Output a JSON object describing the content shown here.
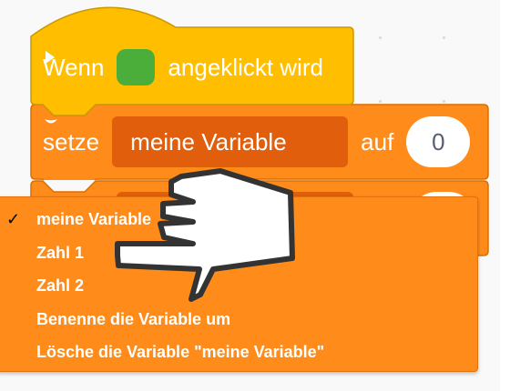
{
  "hat_block": {
    "text_before": "Wenn",
    "text_after": "angeklickt wird",
    "icon": "green-flag-icon"
  },
  "set_block": {
    "label": "setze",
    "variable": "meine Variable",
    "connector": "auf",
    "value": "0"
  },
  "dropdown": {
    "items": [
      {
        "label": "meine Variable",
        "checked": true
      },
      {
        "label": "Zahl 1",
        "checked": false
      },
      {
        "label": "Zahl 2",
        "checked": false
      },
      {
        "label": "Benenne die Variable um",
        "checked": false
      },
      {
        "label": "Lösche die Variable \"meine Variable\"",
        "checked": false
      }
    ],
    "check_mark": "✓"
  },
  "colors": {
    "hat_yellow": "#ffbf00",
    "variable_orange": "#ff8c1a",
    "dropdown_dark": "#e05e0c",
    "flag_green": "#4cae3a"
  }
}
